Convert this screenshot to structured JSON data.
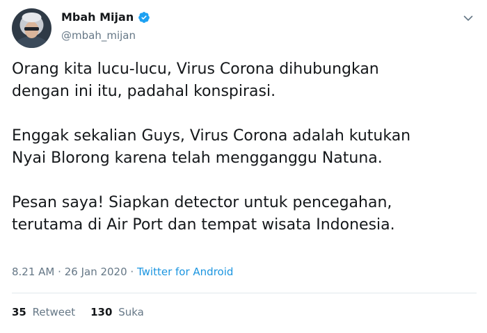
{
  "author": {
    "name": "Mbah Mijan",
    "handle": "@mbah_mijan",
    "verified": true
  },
  "tweet": {
    "paragraphs": [
      "Orang kita lucu-lucu, Virus Corona dihubungkan\ndengan ini itu, padahal konspirasi.",
      "Enggak sekalian Guys, Virus Corona adalah kutukan\nNyai Blorong karena telah mengganggu Natuna.",
      "Pesan saya! Siapkan detector untuk pencegahan,\nterutama di Air Port dan tempat wisata Indonesia."
    ],
    "time": "8.21 AM",
    "separator": "·",
    "date": "26 Jan 2020",
    "source": "Twitter for Android"
  },
  "stats": {
    "retweets": {
      "count": "35",
      "label": "Retweet"
    },
    "likes": {
      "count": "130",
      "label": "Suka"
    }
  },
  "colors": {
    "accent": "#1da1f2",
    "secondary_text": "#657786",
    "primary_text": "#14171a",
    "link": "#1b95e0"
  }
}
